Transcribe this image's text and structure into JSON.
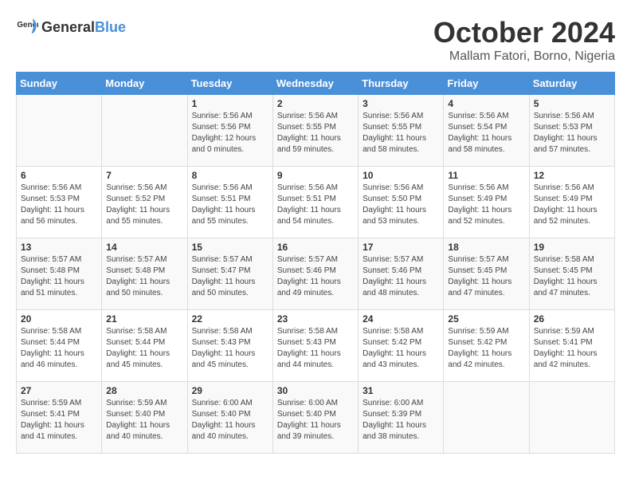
{
  "header": {
    "logo_general": "General",
    "logo_blue": "Blue",
    "month": "October 2024",
    "location": "Mallam Fatori, Borno, Nigeria"
  },
  "days_of_week": [
    "Sunday",
    "Monday",
    "Tuesday",
    "Wednesday",
    "Thursday",
    "Friday",
    "Saturday"
  ],
  "weeks": [
    [
      {
        "day": "",
        "info": ""
      },
      {
        "day": "",
        "info": ""
      },
      {
        "day": "1",
        "info": "Sunrise: 5:56 AM\nSunset: 5:56 PM\nDaylight: 12 hours\nand 0 minutes."
      },
      {
        "day": "2",
        "info": "Sunrise: 5:56 AM\nSunset: 5:55 PM\nDaylight: 11 hours\nand 59 minutes."
      },
      {
        "day": "3",
        "info": "Sunrise: 5:56 AM\nSunset: 5:55 PM\nDaylight: 11 hours\nand 58 minutes."
      },
      {
        "day": "4",
        "info": "Sunrise: 5:56 AM\nSunset: 5:54 PM\nDaylight: 11 hours\nand 58 minutes."
      },
      {
        "day": "5",
        "info": "Sunrise: 5:56 AM\nSunset: 5:53 PM\nDaylight: 11 hours\nand 57 minutes."
      }
    ],
    [
      {
        "day": "6",
        "info": "Sunrise: 5:56 AM\nSunset: 5:53 PM\nDaylight: 11 hours\nand 56 minutes."
      },
      {
        "day": "7",
        "info": "Sunrise: 5:56 AM\nSunset: 5:52 PM\nDaylight: 11 hours\nand 55 minutes."
      },
      {
        "day": "8",
        "info": "Sunrise: 5:56 AM\nSunset: 5:51 PM\nDaylight: 11 hours\nand 55 minutes."
      },
      {
        "day": "9",
        "info": "Sunrise: 5:56 AM\nSunset: 5:51 PM\nDaylight: 11 hours\nand 54 minutes."
      },
      {
        "day": "10",
        "info": "Sunrise: 5:56 AM\nSunset: 5:50 PM\nDaylight: 11 hours\nand 53 minutes."
      },
      {
        "day": "11",
        "info": "Sunrise: 5:56 AM\nSunset: 5:49 PM\nDaylight: 11 hours\nand 52 minutes."
      },
      {
        "day": "12",
        "info": "Sunrise: 5:56 AM\nSunset: 5:49 PM\nDaylight: 11 hours\nand 52 minutes."
      }
    ],
    [
      {
        "day": "13",
        "info": "Sunrise: 5:57 AM\nSunset: 5:48 PM\nDaylight: 11 hours\nand 51 minutes."
      },
      {
        "day": "14",
        "info": "Sunrise: 5:57 AM\nSunset: 5:48 PM\nDaylight: 11 hours\nand 50 minutes."
      },
      {
        "day": "15",
        "info": "Sunrise: 5:57 AM\nSunset: 5:47 PM\nDaylight: 11 hours\nand 50 minutes."
      },
      {
        "day": "16",
        "info": "Sunrise: 5:57 AM\nSunset: 5:46 PM\nDaylight: 11 hours\nand 49 minutes."
      },
      {
        "day": "17",
        "info": "Sunrise: 5:57 AM\nSunset: 5:46 PM\nDaylight: 11 hours\nand 48 minutes."
      },
      {
        "day": "18",
        "info": "Sunrise: 5:57 AM\nSunset: 5:45 PM\nDaylight: 11 hours\nand 47 minutes."
      },
      {
        "day": "19",
        "info": "Sunrise: 5:58 AM\nSunset: 5:45 PM\nDaylight: 11 hours\nand 47 minutes."
      }
    ],
    [
      {
        "day": "20",
        "info": "Sunrise: 5:58 AM\nSunset: 5:44 PM\nDaylight: 11 hours\nand 46 minutes."
      },
      {
        "day": "21",
        "info": "Sunrise: 5:58 AM\nSunset: 5:44 PM\nDaylight: 11 hours\nand 45 minutes."
      },
      {
        "day": "22",
        "info": "Sunrise: 5:58 AM\nSunset: 5:43 PM\nDaylight: 11 hours\nand 45 minutes."
      },
      {
        "day": "23",
        "info": "Sunrise: 5:58 AM\nSunset: 5:43 PM\nDaylight: 11 hours\nand 44 minutes."
      },
      {
        "day": "24",
        "info": "Sunrise: 5:58 AM\nSunset: 5:42 PM\nDaylight: 11 hours\nand 43 minutes."
      },
      {
        "day": "25",
        "info": "Sunrise: 5:59 AM\nSunset: 5:42 PM\nDaylight: 11 hours\nand 42 minutes."
      },
      {
        "day": "26",
        "info": "Sunrise: 5:59 AM\nSunset: 5:41 PM\nDaylight: 11 hours\nand 42 minutes."
      }
    ],
    [
      {
        "day": "27",
        "info": "Sunrise: 5:59 AM\nSunset: 5:41 PM\nDaylight: 11 hours\nand 41 minutes."
      },
      {
        "day": "28",
        "info": "Sunrise: 5:59 AM\nSunset: 5:40 PM\nDaylight: 11 hours\nand 40 minutes."
      },
      {
        "day": "29",
        "info": "Sunrise: 6:00 AM\nSunset: 5:40 PM\nDaylight: 11 hours\nand 40 minutes."
      },
      {
        "day": "30",
        "info": "Sunrise: 6:00 AM\nSunset: 5:40 PM\nDaylight: 11 hours\nand 39 minutes."
      },
      {
        "day": "31",
        "info": "Sunrise: 6:00 AM\nSunset: 5:39 PM\nDaylight: 11 hours\nand 38 minutes."
      },
      {
        "day": "",
        "info": ""
      },
      {
        "day": "",
        "info": ""
      }
    ]
  ]
}
